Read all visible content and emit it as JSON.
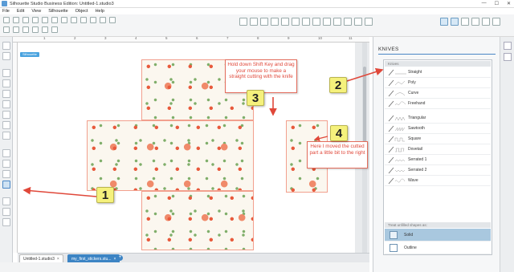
{
  "window": {
    "title": "Silhouette Studio Business Edition: Untitled-1.studio3",
    "minimize": "—",
    "maximize": "☐",
    "close": "✕"
  },
  "menu": [
    "File",
    "Edit",
    "View",
    "Silhouette",
    "Object",
    "Help"
  ],
  "canvas": {
    "page_badge": "Silhouette",
    "ruler_numbers": [
      "1",
      "2",
      "3",
      "4",
      "5",
      "6",
      "7",
      "8",
      "9",
      "10",
      "11"
    ]
  },
  "tabs": [
    {
      "label": "Untitled-1.studio3",
      "close": "×"
    },
    {
      "label": "my_first_stickers.stu...",
      "close": "×"
    }
  ],
  "tab_add": "+",
  "panel": {
    "title": "KNIVES",
    "section_knives": "Knives",
    "knives": [
      "Straight",
      "Poly",
      "Curve",
      "Freehand",
      "Triangular",
      "Sawtooth",
      "Square",
      "Dovetail",
      "Serrated 1",
      "Serrated 2",
      "Wave"
    ],
    "section_unfilled": "Treat unfilled shapes as:",
    "fill_modes": [
      "Solid",
      "Outline"
    ],
    "selected_fill_mode": "Solid"
  },
  "annotations": {
    "badge_1": "1",
    "badge_2": "2",
    "badge_3": "3",
    "badge_4": "4",
    "note_3": "Hold down Shift Key and drag your mouse to make a straight cutting with the knife",
    "note_4": "Here I moved the cutted part a little bit to the right"
  },
  "colors": {
    "annotation_red": "#e0483a",
    "badge_yellow": "#f5f17c",
    "selection_blue": "#a9c8df",
    "accent_blue": "#3c84c4"
  }
}
